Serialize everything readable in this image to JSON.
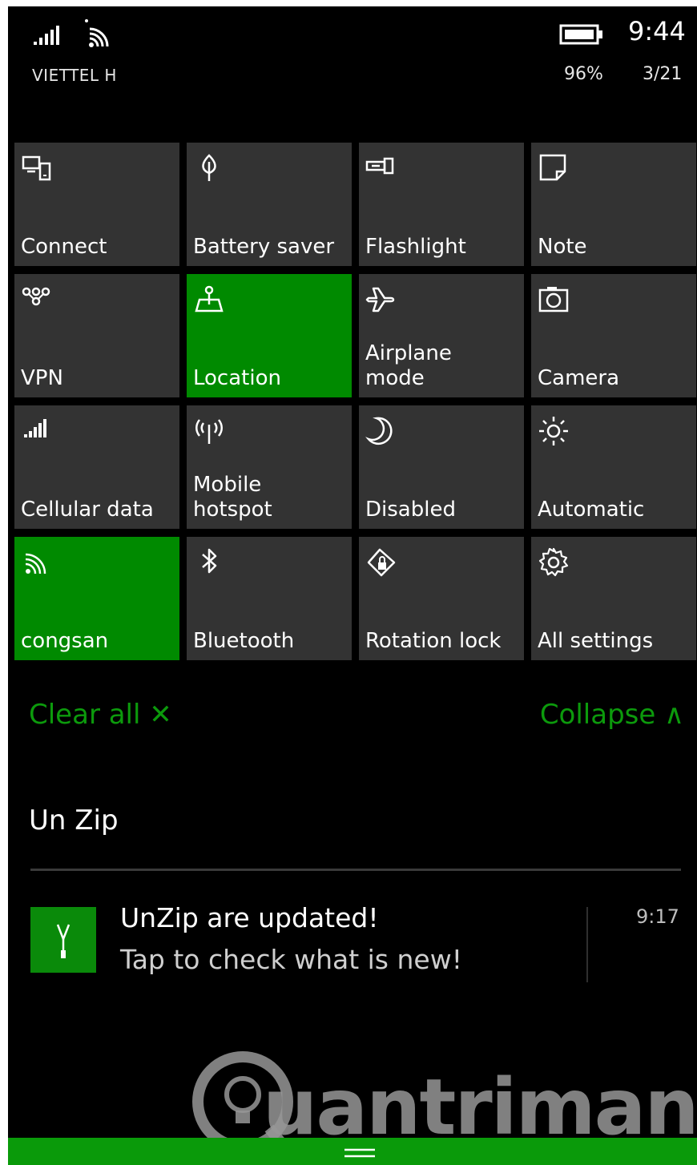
{
  "status_bar": {
    "carrier": "VIETTEL H",
    "time": "9:44",
    "battery_percent": "96%",
    "date": "3/21"
  },
  "quick_actions": [
    {
      "label": "Connect",
      "icon": "connect-icon",
      "active": false
    },
    {
      "label": "Battery saver",
      "icon": "battery-saver-icon",
      "active": false
    },
    {
      "label": "Flashlight",
      "icon": "flashlight-icon",
      "active": false
    },
    {
      "label": "Note",
      "icon": "note-icon",
      "active": false
    },
    {
      "label": "VPN",
      "icon": "vpn-icon",
      "active": false
    },
    {
      "label": "Location",
      "icon": "location-icon",
      "active": true
    },
    {
      "label": "Airplane\nmode",
      "icon": "airplane-icon",
      "active": false
    },
    {
      "label": "Camera",
      "icon": "camera-icon",
      "active": false
    },
    {
      "label": "Cellular data",
      "icon": "cellular-icon",
      "active": false
    },
    {
      "label": "Mobile\nhotspot",
      "icon": "hotspot-icon",
      "active": false
    },
    {
      "label": "Disabled",
      "icon": "quiet-hours-icon",
      "active": false
    },
    {
      "label": "Automatic",
      "icon": "brightness-icon",
      "active": false
    },
    {
      "label": "congsan",
      "icon": "wifi-icon",
      "active": true
    },
    {
      "label": "Bluetooth",
      "icon": "bluetooth-icon",
      "active": false
    },
    {
      "label": "Rotation lock",
      "icon": "rotation-lock-icon",
      "active": false
    },
    {
      "label": "All settings",
      "icon": "gear-icon",
      "active": false
    }
  ],
  "actions": {
    "clear_all": "Clear all ✕",
    "collapse": "Collapse ∧"
  },
  "notifications": {
    "app_name": "Un Zip",
    "items": [
      {
        "title": "UnZip are updated!",
        "body": "Tap to check what is new!",
        "time": "9:17"
      }
    ]
  },
  "watermark": "uantrimang",
  "colors": {
    "accent": "#008a00",
    "tile": "#333333",
    "background": "#000000",
    "link": "#0c9a0c"
  }
}
